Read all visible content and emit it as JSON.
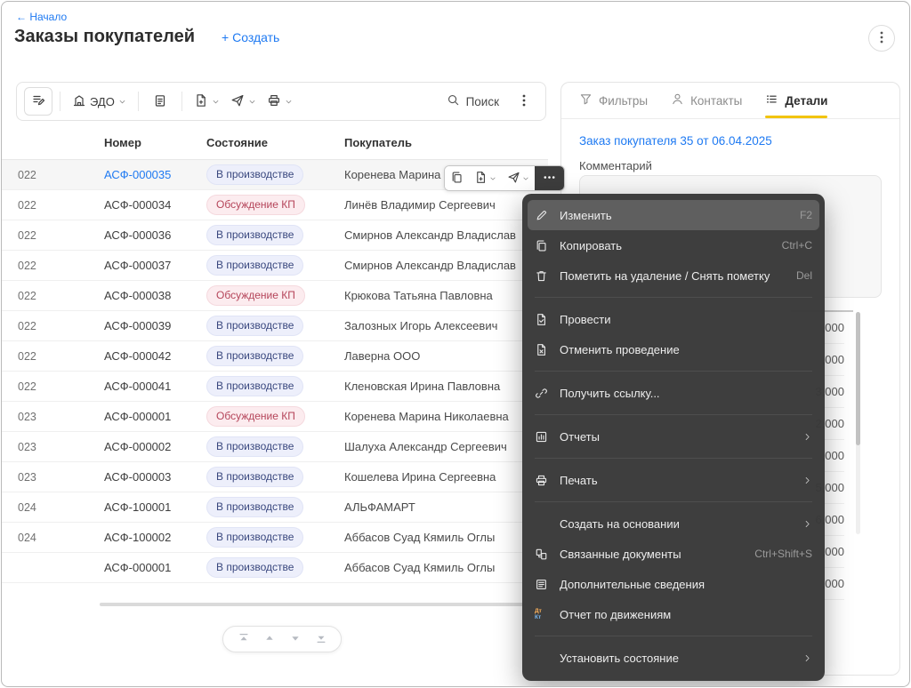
{
  "header": {
    "back_link": "← Начало",
    "title": "Заказы покупателей",
    "create_label": "+ Создать",
    "window_menu_icon": "kebab-icon"
  },
  "toolbar": {
    "edo_label": "ЭДО",
    "search_label": "Поиск",
    "icons": [
      "table-edit-icon",
      "edo-icon",
      "clipboard-icon",
      "doc-plus-icon",
      "send-icon",
      "printer-icon",
      "search-icon",
      "kebab-icon"
    ]
  },
  "table": {
    "columns": {
      "number": "Номер",
      "state": "Состояние",
      "customer": "Покупатель"
    },
    "rows": [
      {
        "date": "022",
        "number": "АСФ-000035",
        "number_is_link": true,
        "state": "В производстве",
        "state_variant": "production",
        "customer": "Коренева Марина",
        "selected": true
      },
      {
        "date": "022",
        "number": "АСФ-000034",
        "state": "Обсуждение КП",
        "state_variant": "discussion",
        "customer": "Линёв Владимир Сергеевич"
      },
      {
        "date": "022",
        "number": "АСФ-000036",
        "state": "В производстве",
        "state_variant": "production",
        "customer": "Смирнов Александр Владислав"
      },
      {
        "date": "022",
        "number": "АСФ-000037",
        "state": "В производстве",
        "state_variant": "production",
        "customer": "Смирнов Александр Владислав"
      },
      {
        "date": "022",
        "number": "АСФ-000038",
        "state": "Обсуждение КП",
        "state_variant": "discussion",
        "customer": "Крюкова Татьяна Павловна"
      },
      {
        "date": "022",
        "number": "АСФ-000039",
        "state": "В производстве",
        "state_variant": "production",
        "customer": "Залозных Игорь Алексеевич"
      },
      {
        "date": "022",
        "number": "АСФ-000042",
        "state": "В производстве",
        "state_variant": "production",
        "customer": "Лаверна ООО"
      },
      {
        "date": "022",
        "number": "АСФ-000041",
        "state": "В производстве",
        "state_variant": "production",
        "customer": "Кленовская Ирина Павловна"
      },
      {
        "date": "023",
        "number": "АСФ-000001",
        "state": "Обсуждение КП",
        "state_variant": "discussion",
        "customer": "Коренева Марина Николаевна"
      },
      {
        "date": "023",
        "number": "АСФ-000002",
        "state": "В производстве",
        "state_variant": "production",
        "customer": "Шалуха Александр Сергеевич"
      },
      {
        "date": "023",
        "number": "АСФ-000003",
        "state": "В производстве",
        "state_variant": "production",
        "customer": "Кошелева Ирина Сергеевна"
      },
      {
        "date": "024",
        "number": "АСФ-100001",
        "state": "В производстве",
        "state_variant": "production",
        "customer": "АЛЬФАМАРТ"
      },
      {
        "date": "024",
        "number": "АСФ-100002",
        "state": "В производстве",
        "state_variant": "production",
        "customer": "Аббасов Суад Кямиль Оглы"
      },
      {
        "date": "",
        "number": "АСФ-000001",
        "state": "В производстве",
        "state_variant": "production",
        "customer": "Аббасов Суад Кямиль Оглы"
      }
    ]
  },
  "row_toolbar": {
    "buttons": [
      {
        "name": "copy",
        "icon": "copy-icon"
      },
      {
        "name": "create-based-on",
        "icon": "doc-plus-icon",
        "dropdown": true
      },
      {
        "name": "send",
        "icon": "send-icon",
        "dropdown": true
      },
      {
        "name": "more",
        "icon": "ellipsis-icon",
        "active": true
      }
    ]
  },
  "details": {
    "tabs": [
      {
        "label": "Фильтры",
        "icon": "funnel-icon"
      },
      {
        "label": "Контакты",
        "icon": "person-icon"
      },
      {
        "label": "Детали",
        "icon": "details-icon",
        "active": true
      }
    ],
    "doc_link": "Заказ покупателя 35 от 06.04.2025",
    "comment_label": "Комментарий",
    "amounts": [
      ",000",
      ",000",
      "3,000",
      "2,000",
      ",000",
      "5,000",
      "6,000",
      ",000",
      ",000"
    ]
  },
  "context_menu": {
    "groups": [
      {
        "items": [
          {
            "icon": "pencil-icon",
            "label": "Изменить",
            "shortcut": "F2",
            "highlighted": true
          },
          {
            "icon": "copy-icon",
            "label": "Копировать",
            "shortcut": "Ctrl+C"
          },
          {
            "icon": "trash-icon",
            "label": "Пометить на удаление / Снять пометку",
            "shortcut": "Del"
          }
        ]
      },
      {
        "items": [
          {
            "icon": "doc-post-icon",
            "label": "Провести"
          },
          {
            "icon": "doc-unpost-icon",
            "label": "Отменить проведение"
          }
        ]
      },
      {
        "items": [
          {
            "icon": "link-icon",
            "label": "Получить ссылку..."
          }
        ]
      },
      {
        "items": [
          {
            "icon": "report-icon",
            "label": "Отчеты",
            "submenu": true
          }
        ]
      },
      {
        "items": [
          {
            "icon": "printer-icon",
            "label": "Печать",
            "submenu": true
          }
        ]
      },
      {
        "items": [
          {
            "label": "Создать на основании",
            "submenu": true
          },
          {
            "icon": "linked-docs-icon",
            "label": "Связанные документы",
            "shortcut": "Ctrl+Shift+S"
          },
          {
            "icon": "list-icon",
            "label": "Дополнительные сведения"
          },
          {
            "icon": "dtkt-icon",
            "label": "Отчет по движениям"
          }
        ]
      },
      {
        "items": [
          {
            "label": "Установить состояние",
            "submenu": true
          }
        ]
      }
    ]
  },
  "pagination": {
    "buttons": [
      "go-top-icon",
      "up-icon",
      "down-icon",
      "go-bottom-icon"
    ]
  },
  "colors": {
    "accent_blue": "#1f7af2",
    "tab_underline_yellow": "#f2c40f",
    "status_production_bg": "#edeffb",
    "status_production_text": "#39477e",
    "status_discussion_bg": "#fcecef",
    "status_discussion_text": "#b5455a",
    "context_menu_bg": "#383838",
    "context_menu_highlight": "#5f5f5f"
  }
}
